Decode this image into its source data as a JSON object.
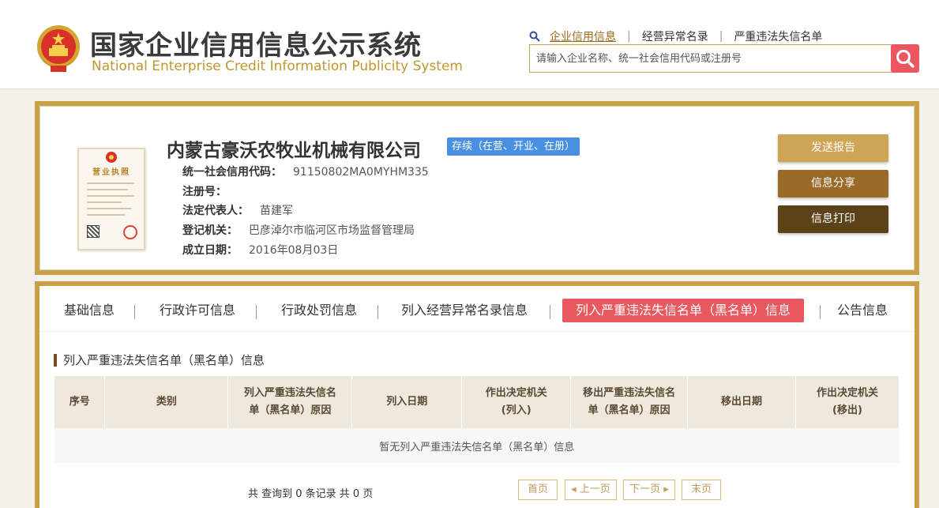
{
  "header": {
    "title_cn": "国家企业信用信息公示系统",
    "title_en": "National Enterprise Credit Information Publicity System",
    "top_links": [
      "企业信用信息",
      "经营异常名录",
      "严重违法失信名单"
    ],
    "search_placeholder": "请输入企业名称、统一社会信用代码或注册号"
  },
  "license": {
    "title": "营业执照"
  },
  "company": {
    "name": "内蒙古豪沃农牧业机械有限公司",
    "status": "存续（在营、开业、在册）",
    "fields": [
      {
        "label": "统一社会信用代码：",
        "value": "91150802MA0MYHM335"
      },
      {
        "label": "注册号：",
        "value": ""
      },
      {
        "label": "法定代表人：",
        "value": "苗建军"
      },
      {
        "label": "登记机关：",
        "value": "巴彦淖尔市临河区市场监督管理局"
      },
      {
        "label": "成立日期：",
        "value": "2016年08月03日"
      }
    ]
  },
  "actions": {
    "report": "发送报告",
    "share": "信息分享",
    "print": "信息打印"
  },
  "tabs": [
    "基础信息",
    "行政许可信息",
    "行政处罚信息",
    "列入经营异常名录信息",
    "列入严重违法失信名单（黑名单）信息",
    "公告信息"
  ],
  "section": {
    "title": "列入严重违法失信名单（黑名单）信息",
    "columns": [
      [
        "序号"
      ],
      [
        "类别"
      ],
      [
        "列入严重违法失信名",
        "单（黑名单）原因"
      ],
      [
        "列入日期"
      ],
      [
        "作出决定机关",
        "(列入)"
      ],
      [
        "移出严重违法失信名",
        "单（黑名单）原因"
      ],
      [
        "移出日期"
      ],
      [
        "作出决定机关",
        "(移出)"
      ]
    ],
    "empty_text": "暂无列入严重违法失信名单（黑名单）信息"
  },
  "pagination": {
    "summary": "共 查询到 0 条记录 共 0 页",
    "first": "首页",
    "prev": "◂ 上一页",
    "next": "下一页 ▸",
    "last": "末页"
  },
  "colors": {
    "gold": "#c8a048",
    "accent_red": "#e8585e",
    "badge_blue": "#4a90e2"
  }
}
